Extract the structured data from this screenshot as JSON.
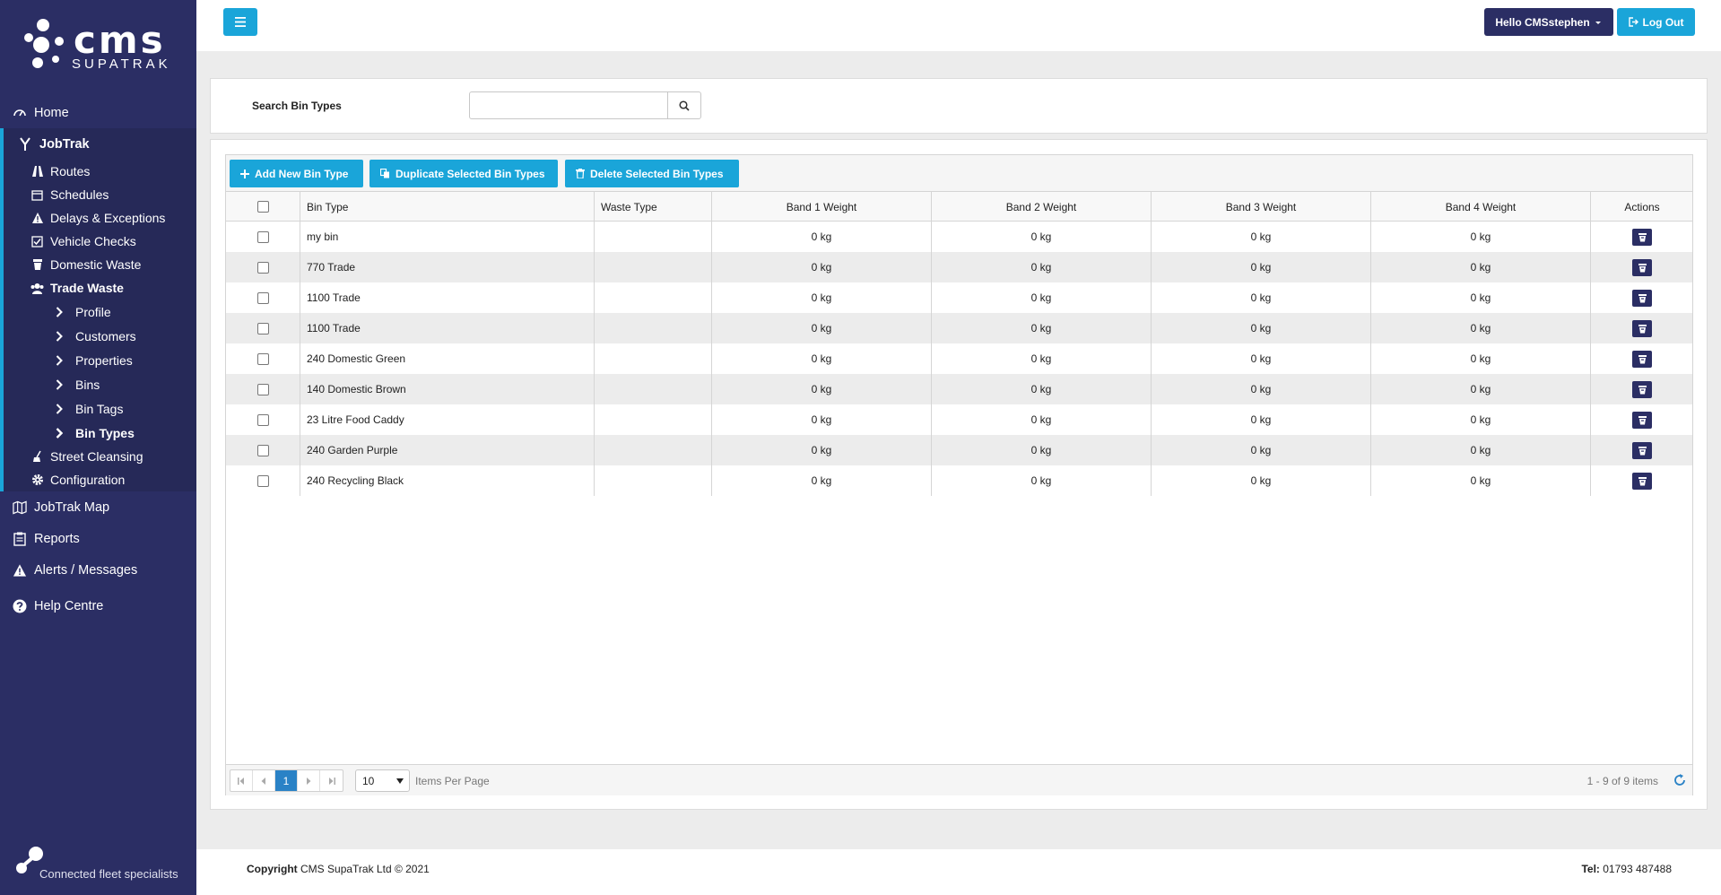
{
  "colors": {
    "sidebar": "#2b2e64",
    "accent": "#1aa5d9",
    "active_page": "#2a82c6"
  },
  "brand": {
    "name": "cms",
    "sub": "SUPATRAK",
    "tagline": "Connected fleet specialists"
  },
  "sidebar": {
    "home": "Home",
    "jobtrak": "JobTrak",
    "jobtrak_items": [
      {
        "label": "Routes",
        "icon": "road-icon"
      },
      {
        "label": "Schedules",
        "icon": "calendar-icon"
      },
      {
        "label": "Delays & Exceptions",
        "icon": "warning-icon"
      },
      {
        "label": "Vehicle Checks",
        "icon": "check-square-icon"
      },
      {
        "label": "Domestic Waste",
        "icon": "bin-icon"
      },
      {
        "label": "Trade Waste",
        "icon": "users-icon"
      }
    ],
    "trade_items": [
      "Profile",
      "Customers",
      "Properties",
      "Bins",
      "Bin Tags",
      "Bin Types"
    ],
    "street_cleansing": "Street Cleansing",
    "configuration": "Configuration",
    "jobtrak_map": "JobTrak Map",
    "reports": "Reports",
    "alerts": "Alerts / Messages",
    "help": "Help Centre"
  },
  "topbar": {
    "hello": "Hello CMSstephen",
    "logout": "Log Out"
  },
  "search": {
    "label": "Search Bin Types",
    "value": ""
  },
  "toolbar": {
    "add": "Add New Bin Type",
    "duplicate": "Duplicate Selected Bin Types",
    "delete": "Delete Selected Bin Types"
  },
  "table": {
    "headers": [
      "Bin Type",
      "Waste Type",
      "Band 1 Weight",
      "Band 2 Weight",
      "Band 3 Weight",
      "Band 4 Weight",
      "Actions"
    ],
    "rows": [
      {
        "name": "my bin",
        "waste": "",
        "b1": "0 kg",
        "b2": "0 kg",
        "b3": "0 kg",
        "b4": "0 kg"
      },
      {
        "name": "770 Trade",
        "waste": "",
        "b1": "0 kg",
        "b2": "0 kg",
        "b3": "0 kg",
        "b4": "0 kg"
      },
      {
        "name": "1100 Trade",
        "waste": "",
        "b1": "0 kg",
        "b2": "0 kg",
        "b3": "0 kg",
        "b4": "0 kg"
      },
      {
        "name": "1100 Trade",
        "waste": "",
        "b1": "0 kg",
        "b2": "0 kg",
        "b3": "0 kg",
        "b4": "0 kg"
      },
      {
        "name": "240 Domestic Green",
        "waste": "",
        "b1": "0 kg",
        "b2": "0 kg",
        "b3": "0 kg",
        "b4": "0 kg"
      },
      {
        "name": "140 Domestic Brown",
        "waste": "",
        "b1": "0 kg",
        "b2": "0 kg",
        "b3": "0 kg",
        "b4": "0 kg"
      },
      {
        "name": "23 Litre Food Caddy",
        "waste": "",
        "b1": "0 kg",
        "b2": "0 kg",
        "b3": "0 kg",
        "b4": "0 kg"
      },
      {
        "name": "240 Garden Purple",
        "waste": "",
        "b1": "0 kg",
        "b2": "0 kg",
        "b3": "0 kg",
        "b4": "0 kg"
      },
      {
        "name": "240 Recycling Black",
        "waste": "",
        "b1": "0 kg",
        "b2": "0 kg",
        "b3": "0 kg",
        "b4": "0 kg"
      }
    ]
  },
  "pager": {
    "current_page": "1",
    "page_size": "10",
    "items_per_page": "Items Per Page",
    "info": "1 - 9 of 9 items"
  },
  "footer": {
    "copyright_label": "Copyright",
    "copyright_text": "CMS SupaTrak Ltd © 2021",
    "tel_label": "Tel:",
    "tel_number": "01793 487488"
  }
}
